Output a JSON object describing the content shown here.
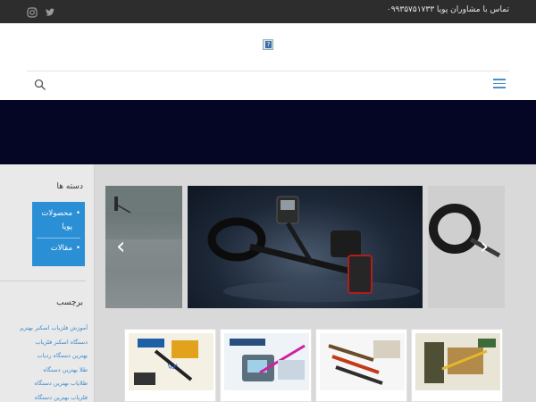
{
  "topbar": {
    "contact_text": "تماس با مشاوران پویا ۰۹۹۳۵۷۵۱۷۳۳",
    "social_icons": [
      "twitter-icon",
      "instagram-icon"
    ]
  },
  "header": {
    "logo_icon": "broken-image-icon",
    "logo_glyph": "?"
  },
  "nav": {
    "search_icon": "search-icon",
    "menu_icon": "hamburger-menu-icon",
    "accent_color": "#4a90c6"
  },
  "banner": {
    "background_color": "#050526"
  },
  "sidebar": {
    "categories_title": "دسته ها",
    "categories": [
      {
        "label": "محصولات پویا"
      },
      {
        "label": "مقالات"
      }
    ],
    "categories_color": "#2b8fd6",
    "tags_title": "برچسب",
    "tags": [
      "آموزش فلزیاب اسکنر بهترین",
      "دستگاه اسکنر فلزیاب",
      "بهترین دستگاه ردیاب",
      "طلا بهترین دستگاه",
      "طلایاب بهترین دستگاه",
      "فلزیاب بهترین دستگاه"
    ]
  },
  "slider": {
    "prev_arrow": "‹",
    "next_arrow": "›"
  }
}
